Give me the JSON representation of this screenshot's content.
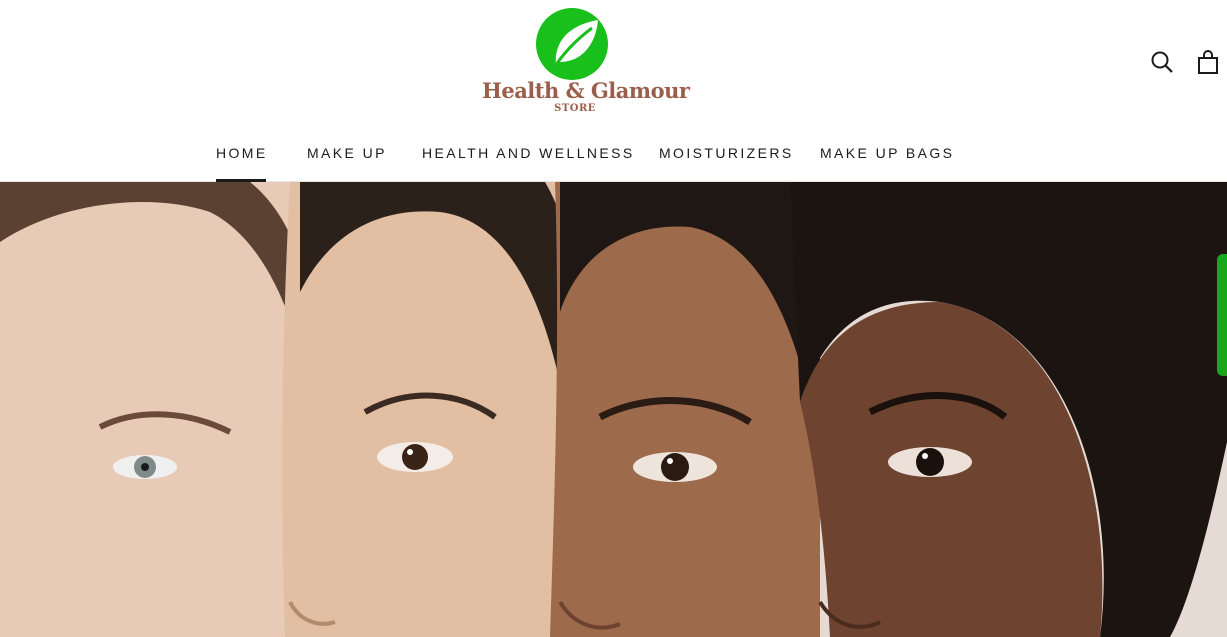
{
  "brand": {
    "name": "Health & Glamour",
    "sub": "STORE",
    "leaf_color": "#19c01c",
    "text_color": "#9a5f4a"
  },
  "header": {
    "search_icon": "search-icon",
    "cart_icon": "shopping-bag-icon"
  },
  "nav": {
    "items": [
      {
        "label": "HOME",
        "active": true
      },
      {
        "label": "MAKE UP",
        "active": false
      },
      {
        "label": "HEALTH AND WELLNESS",
        "active": false
      },
      {
        "label": "MOISTURIZERS",
        "active": false
      },
      {
        "label": "MAKE UP BAGS",
        "active": false
      }
    ]
  },
  "hero": {
    "image": "four-women-faces-photo"
  },
  "side_tab": {
    "color": "#19a81d"
  }
}
